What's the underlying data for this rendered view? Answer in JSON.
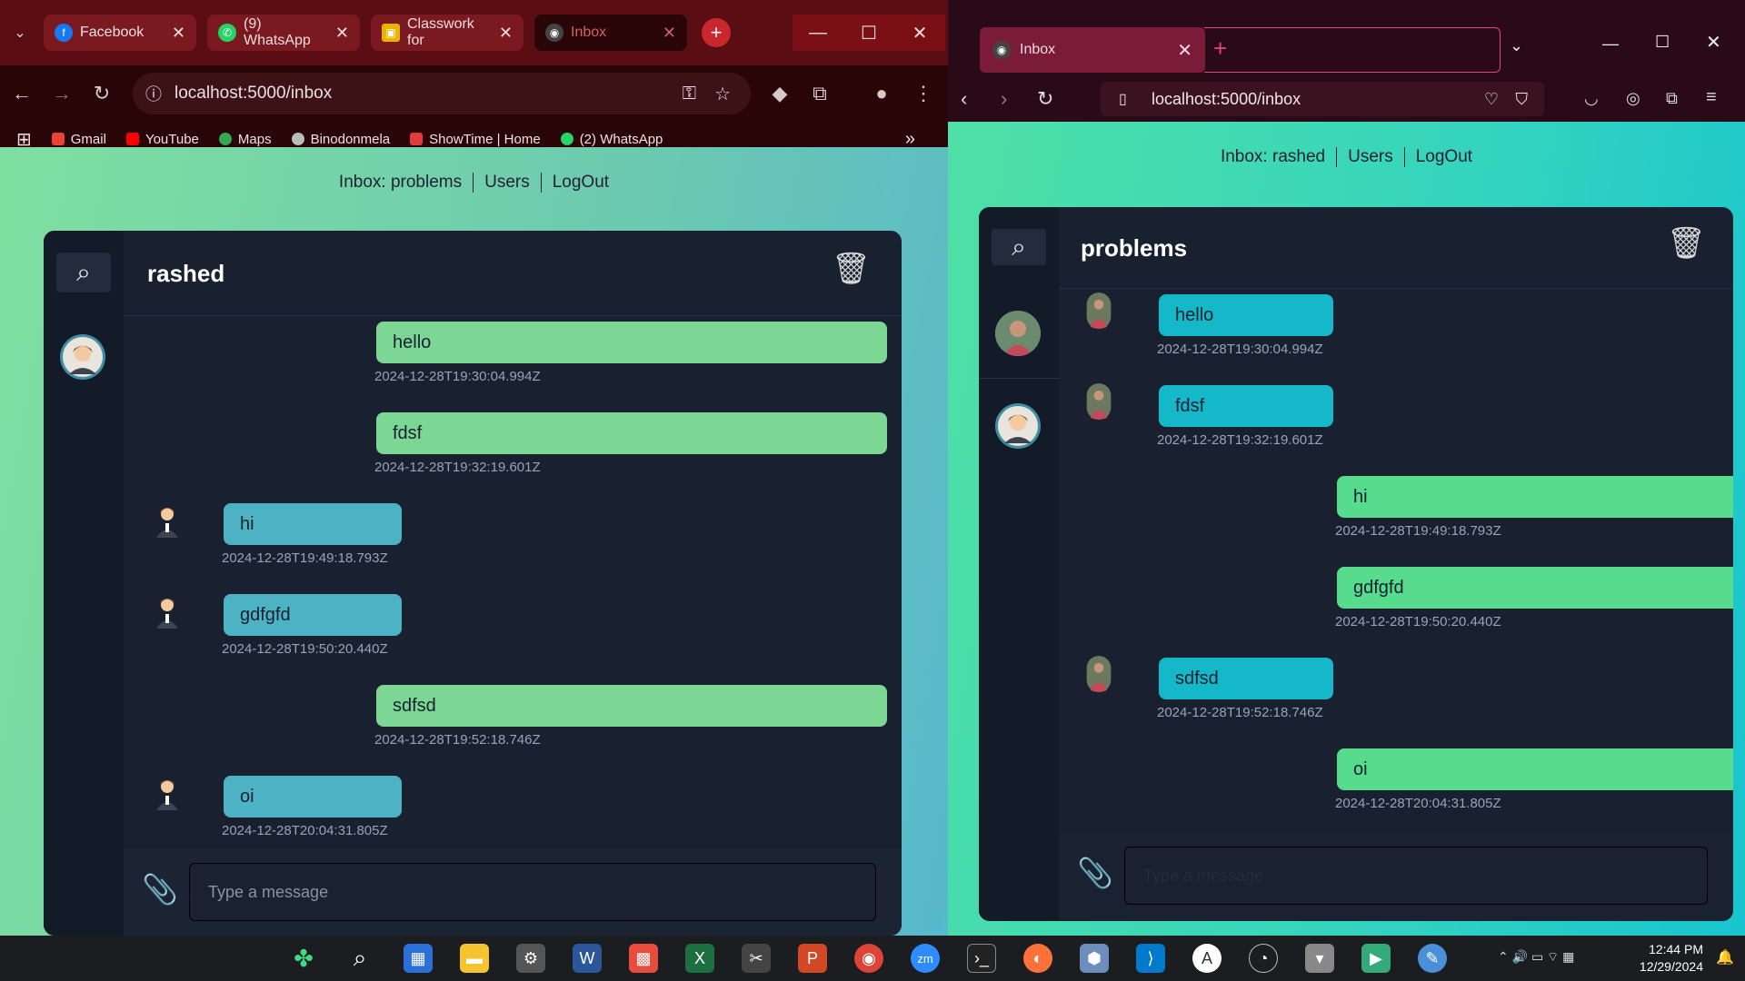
{
  "chrome": {
    "tabs": [
      {
        "label": "Facebook",
        "icon": "facebook-icon",
        "color": "#1877f2"
      },
      {
        "label": "(9) WhatsApp",
        "icon": "whatsapp-icon",
        "color": "#25d366"
      },
      {
        "label": "Classwork for",
        "icon": "classroom-icon",
        "color": "#e8b400"
      },
      {
        "label": "Inbox",
        "icon": "inbox-icon",
        "color": "#c44"
      }
    ],
    "url": "localhost:5000/inbox",
    "bookmarks": [
      "Gmail",
      "YouTube",
      "Maps",
      "Binodonmela",
      "ShowTime | Home",
      "(2) WhatsApp"
    ],
    "page": {
      "nav": [
        "Inbox: problems",
        "Users",
        "LogOut"
      ],
      "chat_title": "rashed",
      "messages": [
        {
          "text": "hello",
          "time": "2024-12-28T19:30:04.994Z",
          "side": "right"
        },
        {
          "text": "fdsf",
          "time": "2024-12-28T19:32:19.601Z",
          "side": "right"
        },
        {
          "text": "hi",
          "time": "2024-12-28T19:49:18.793Z",
          "side": "left"
        },
        {
          "text": "gdfgfd",
          "time": "2024-12-28T19:50:20.440Z",
          "side": "left"
        },
        {
          "text": "sdfsd",
          "time": "2024-12-28T19:52:18.746Z",
          "side": "right"
        },
        {
          "text": "oi",
          "time": "2024-12-28T20:04:31.805Z",
          "side": "left"
        }
      ],
      "input_placeholder": "Type a message"
    }
  },
  "firefox": {
    "tab": "Inbox",
    "url": "localhost:5000/inbox",
    "page": {
      "nav": [
        "Inbox: rashed",
        "Users",
        "LogOut"
      ],
      "chat_title": "problems",
      "messages": [
        {
          "text": "hello",
          "time": "2024-12-28T19:30:04.994Z",
          "side": "left"
        },
        {
          "text": "fdsf",
          "time": "2024-12-28T19:32:19.601Z",
          "side": "left"
        },
        {
          "text": "hi",
          "time": "2024-12-28T19:49:18.793Z",
          "side": "right"
        },
        {
          "text": "gdfgfd",
          "time": "2024-12-28T19:50:20.440Z",
          "side": "right"
        },
        {
          "text": "sdfsd",
          "time": "2024-12-28T19:52:18.746Z",
          "side": "left"
        },
        {
          "text": "oi",
          "time": "2024-12-28T20:04:31.805Z",
          "side": "right"
        }
      ],
      "input_placeholder": "Type a message"
    }
  },
  "taskbar": {
    "time": "12:44 PM",
    "date": "12/29/2024"
  },
  "colors": {
    "bubble_green": "#7cd694",
    "bubble_teal": "#4db3c4",
    "ff_bubble_green": "#56dc8c",
    "ff_bubble_teal": "#14b8c8"
  }
}
